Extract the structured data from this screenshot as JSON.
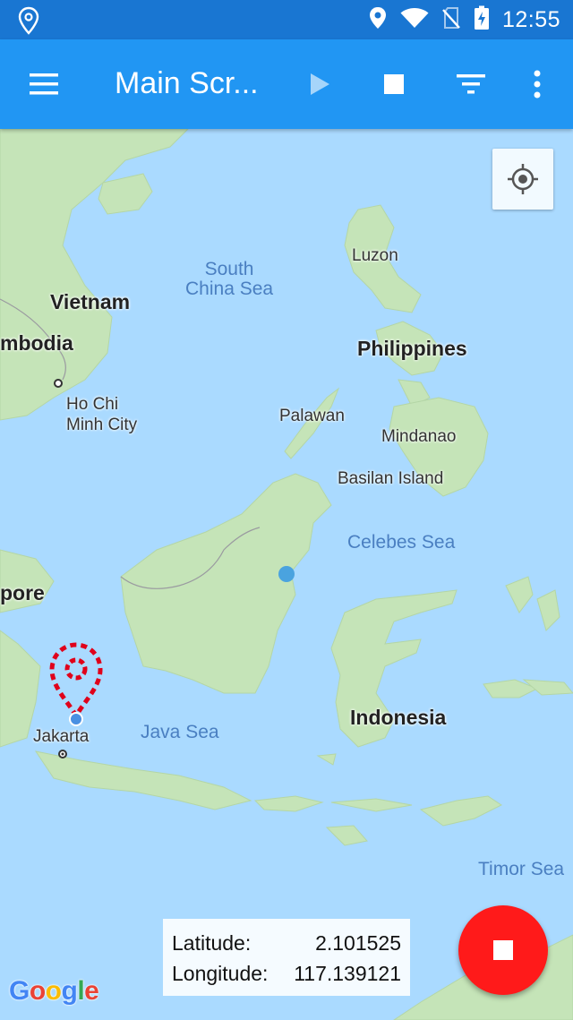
{
  "status_bar": {
    "time": "12:55",
    "icons": [
      "location-pin-icon",
      "location-icon",
      "wifi-icon",
      "no-sim-icon",
      "battery-charging-icon"
    ]
  },
  "app_bar": {
    "title": "Main Scr...",
    "actions": [
      "play-icon",
      "stop-icon",
      "filter-icon",
      "more-vert-icon"
    ]
  },
  "map": {
    "labels": {
      "vietnam": "Vietnam",
      "cambodia": "mbodia",
      "ho_chi_minh": "Ho Chi\nMinh City",
      "south_china_sea": "South\nChina Sea",
      "luzon": "Luzon",
      "philippines": "Philippines",
      "palawan": "Palawan",
      "mindanao": "Mindanao",
      "basilan": "Basilan Island",
      "celebes_sea": "Celebes Sea",
      "singapore": "pore",
      "jakarta": "Jakarta",
      "java_sea": "Java Sea",
      "indonesia": "Indonesia",
      "timor_sea": "Timor Sea"
    }
  },
  "coordinates": {
    "latitude_label": "Latitude:",
    "latitude_value": "2.101525",
    "longitude_label": "Longitude:",
    "longitude_value": "117.139121"
  },
  "attribution": "Google",
  "colors": {
    "status_bar": "#1976d2",
    "app_bar": "#2196f3",
    "water": "#aadaff",
    "land": "#c5e4b8",
    "fab": "#ff1a1a",
    "marker": "#e0001a",
    "current_location": "#4a90e2"
  }
}
